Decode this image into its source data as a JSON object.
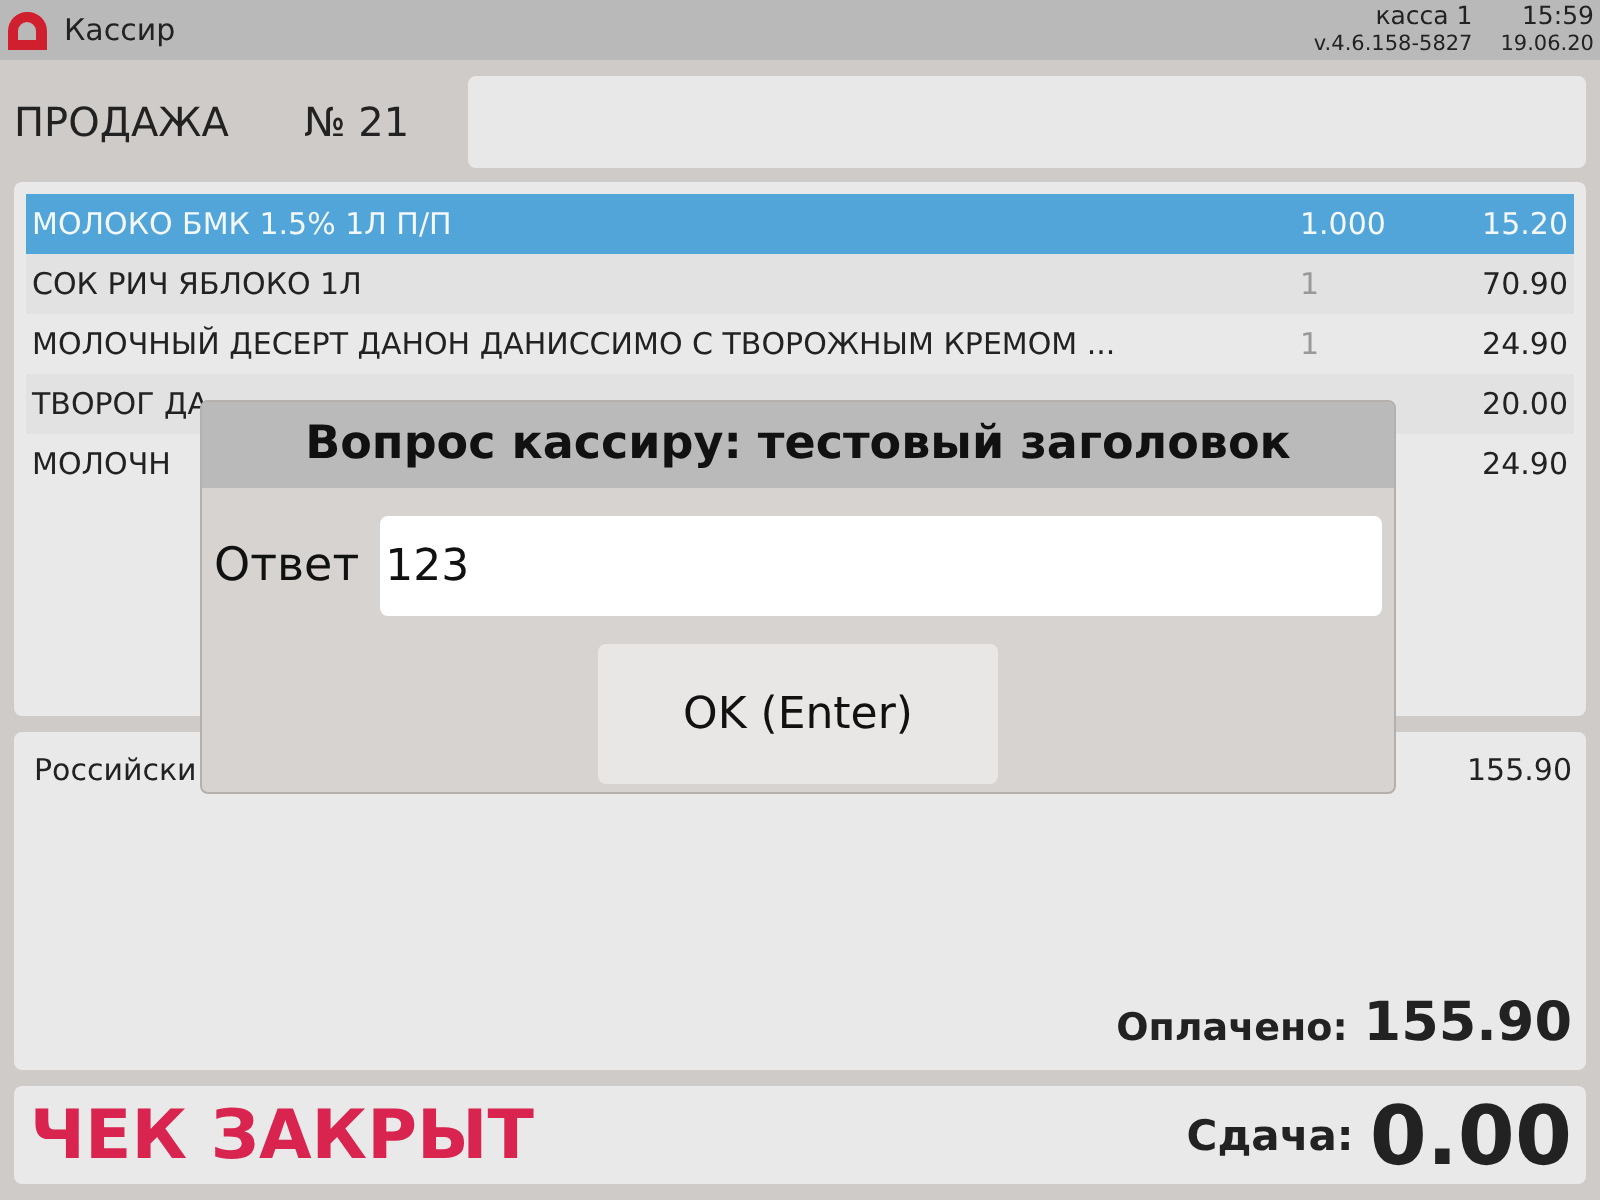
{
  "header": {
    "app_title": "Кассир",
    "register": "касса 1",
    "time": "15:59",
    "version": "v.4.6.158-5827",
    "date": "19.06.20"
  },
  "sale": {
    "title": "ПРОДАЖА",
    "number": "№ 21"
  },
  "items": [
    {
      "name": "МОЛОКО БМК 1.5% 1Л П/П",
      "qty": "1.000",
      "price": "15.20",
      "selected": true
    },
    {
      "name": "СОК РИЧ ЯБЛОКО 1Л",
      "qty": "1",
      "price": "70.90",
      "selected": false
    },
    {
      "name": "МОЛОЧНЫЙ ДЕСЕРТ ДАНОН ДАНИССИМО С ТВОРОЖНЫМ КРЕМОМ ...",
      "qty": "1",
      "price": "24.90",
      "selected": false
    },
    {
      "name": "ТВОРОГ ДА",
      "price": "20.00",
      "selected": false
    },
    {
      "name": "МОЛОЧН",
      "price": "24.90",
      "selected": false
    }
  ],
  "payments": [
    {
      "name": "Российски",
      "amount": "155.90"
    }
  ],
  "paid": {
    "label": "Оплачено:",
    "value": "155.90"
  },
  "status": {
    "text": "ЧЕК ЗАКРЫТ",
    "change_label": "Сдача:",
    "change_value": "0.00"
  },
  "dialog": {
    "title": "Вопрос кассиру: тестовый заголовок",
    "field_label": "Ответ",
    "value": "123",
    "button": "OK (Enter)"
  }
}
